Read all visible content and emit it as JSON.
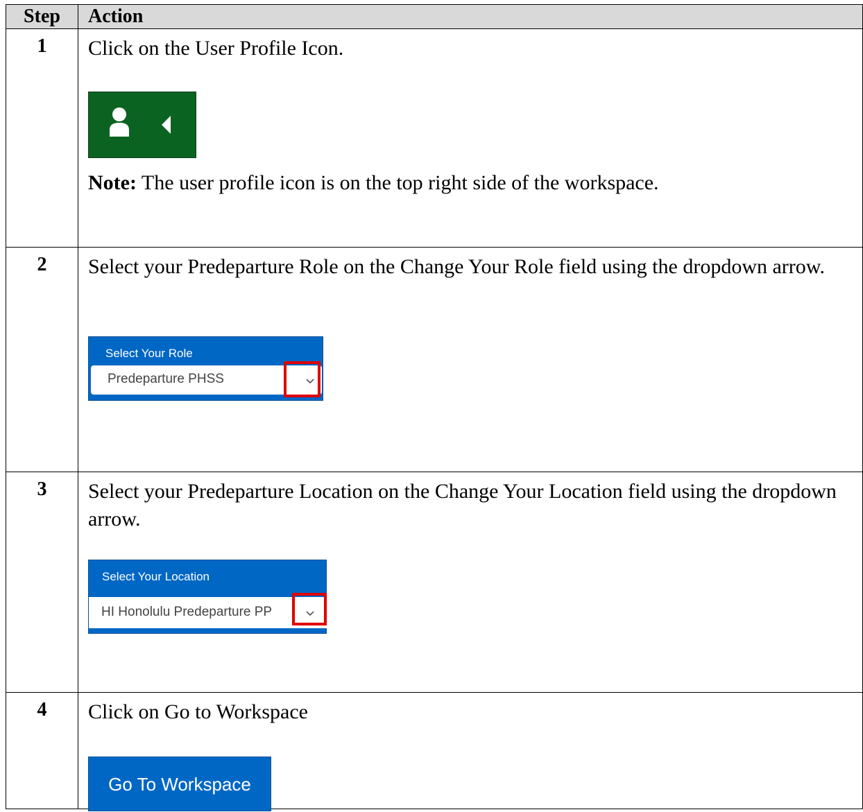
{
  "table": {
    "headers": {
      "step": "Step",
      "action": "Action"
    },
    "rows": [
      {
        "step": "1",
        "instruction": "Click on the User Profile Icon.",
        "note_label": "Note:",
        "note_text": " The user profile icon is on the top right side of the workspace."
      },
      {
        "step": "2",
        "instruction": "Select your Predeparture Role on the Change Your Role field using the dropdown arrow.",
        "widget_label": "Select Your Role",
        "widget_value": "Predeparture PHSS"
      },
      {
        "step": "3",
        "instruction": "Select your Predeparture Location on the Change Your Location field using the dropdown arrow.",
        "widget_label": "Select Your Location",
        "widget_value": "HI Honolulu Predeparture PP "
      },
      {
        "step": "4",
        "instruction": "Click on Go to Workspace",
        "button_label": "Go To Workspace"
      }
    ]
  },
  "icons": [
    "user-profile-icon",
    "caret-left-icon",
    "chevron-down-icon"
  ],
  "colors": {
    "profile_green": "#0b6321",
    "widget_blue": "#0067c5",
    "highlight_red": "#e00000",
    "header_gray": "#d9d9d9"
  }
}
